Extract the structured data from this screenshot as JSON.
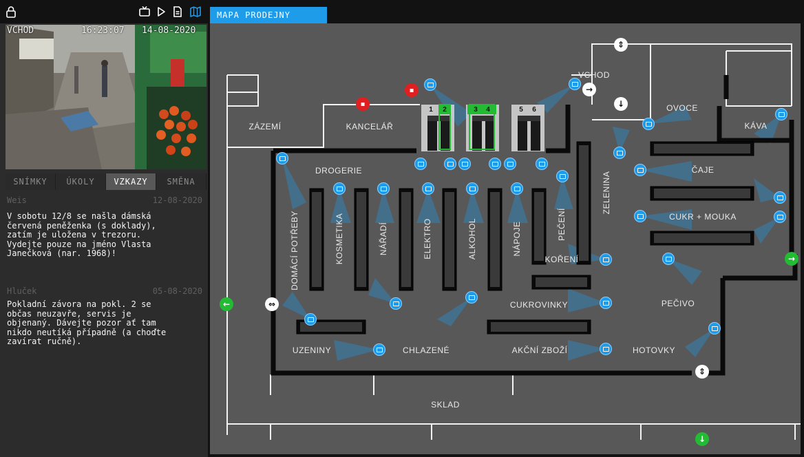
{
  "left_panel": {
    "camera": {
      "name": "VCHOD",
      "time": "16:23:07",
      "date": "14-08-2020"
    },
    "tabs": [
      {
        "label": "SNÍMKY",
        "active": false
      },
      {
        "label": "ÚKOLY",
        "active": false
      },
      {
        "label": "VZKAZY",
        "active": true
      },
      {
        "label": "SMĚNA",
        "active": false
      }
    ],
    "notes": [
      {
        "author": "Weis",
        "date": "12-08-2020",
        "text": "V sobotu 12/8 se našla dámská\nčervená peněženka (s doklady),\nzatím je uložena v trezoru.\nVydejte pouze na jméno Vlasta\nJanečková (nar. 1968)!"
      },
      {
        "author": "Hluček",
        "date": "05-08-2020",
        "text": "Pokladní závora na pokl. 2 se\nobčas neuzavře, servis je\nobjenaný. Dávejte pozor ať tam\nnikdo neutíká případně (a choďte\nzavírat ručně)."
      }
    ],
    "toolbar_icons": [
      "lock-icon",
      "tv-icon",
      "play-icon",
      "document-icon",
      "map-icon"
    ]
  },
  "map": {
    "tab_label": "MAPA PRODEJNY",
    "accent_color": "#1e9be9",
    "rooms": {
      "vchod": "VCHOD",
      "zazemi": "ZÁZEMÍ",
      "kancelar": "KANCELÁŘ",
      "ovoce": "OVOCE",
      "kava": "KÁVA",
      "caje": "ČAJE",
      "cukr": "CUKR + MOUKA",
      "zelenina": "ZELENINA",
      "drogerie": "DROGERIE",
      "domaci": "DOMÁCÍ POTŘEBY",
      "kosmetika": "KOSMETIKA",
      "naradi": "NÁŘADÍ",
      "elektro": "ELEKTRO",
      "alkohol": "ALKOHOL",
      "napoje": "NÁPOJE",
      "peceni": "PEČENÍ",
      "koreni": "KOŘENÍ",
      "cukrovinky": "CUKROVINKY",
      "pecivo": "PEČIVO",
      "uzeniny": "UZENINY",
      "chlazene": "CHLAZENÉ",
      "akcni": "AKČNÍ ZBOŽÍ",
      "hotovky": "HOTOVKY",
      "sklad": "SKLAD"
    },
    "tills": [
      "1",
      "2",
      "3",
      "4",
      "5",
      "6"
    ]
  }
}
